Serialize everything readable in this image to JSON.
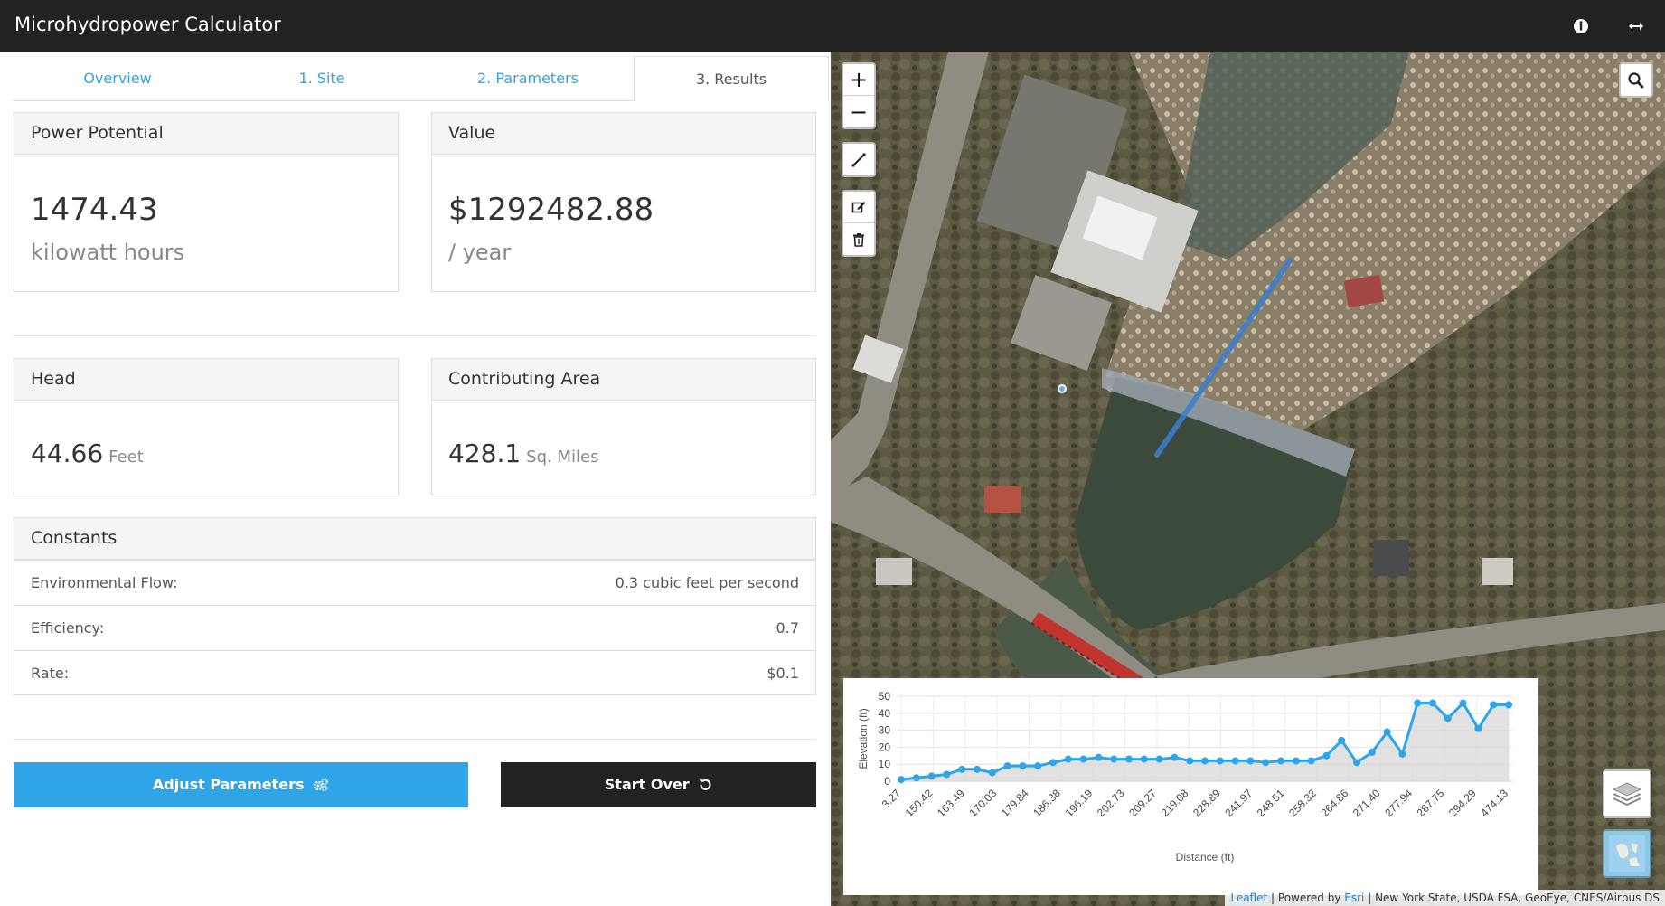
{
  "header": {
    "title": "Microhydropower Calculator"
  },
  "tabs": [
    {
      "label": "Overview"
    },
    {
      "label": "1. Site"
    },
    {
      "label": "2. Parameters"
    },
    {
      "label": "3. Results"
    }
  ],
  "power": {
    "heading": "Power Potential",
    "value": "1474.43",
    "unit": "kilowatt hours"
  },
  "value_panel": {
    "heading": "Value",
    "value": "$1292482.88",
    "unit": "/ year"
  },
  "head": {
    "heading": "Head",
    "value": "44.66",
    "unit": "Feet"
  },
  "area": {
    "heading": "Contributing Area",
    "value": "428.1",
    "unit": "Sq. Miles"
  },
  "constants": {
    "heading": "Constants",
    "rows": [
      {
        "label": "Environmental Flow:",
        "value": "0.3 cubic feet per second"
      },
      {
        "label": "Efficiency:",
        "value": "0.7"
      },
      {
        "label": "Rate:",
        "value": "$0.1"
      }
    ]
  },
  "buttons": {
    "adjust": "Adjust Parameters",
    "start_over": "Start Over"
  },
  "map": {
    "controls": {
      "zoom_in": "+",
      "zoom_out": "−"
    },
    "attribution": {
      "leaflet": "Leaflet",
      "powered_by": "| Powered by",
      "esri": "Esri",
      "sources": "| New York State, USDA FSA, GeoEye, CNES/Airbus DS"
    }
  },
  "colors": {
    "accent": "#2fa4e7",
    "navbar": "#222222",
    "profile_line": "#2fa4e7"
  },
  "chart_data": {
    "type": "area",
    "xlabel": "Distance (ft)",
    "ylabel": "Elevation (ft)",
    "ylim": [
      0,
      50
    ],
    "yticks": [
      0,
      10,
      20,
      30,
      40,
      50
    ],
    "grid": true,
    "x_tick_labels": [
      "3.27",
      "150.42",
      "163.49",
      "170.03",
      "179.84",
      "186.38",
      "196.19",
      "202.73",
      "209.27",
      "219.08",
      "228.89",
      "241.97",
      "248.51",
      "258.32",
      "264.86",
      "271.40",
      "277.94",
      "287.75",
      "294.29",
      "474.13"
    ],
    "values": [
      1,
      2,
      3,
      4,
      7,
      7,
      5,
      9,
      9,
      9,
      11,
      13,
      13,
      14,
      13,
      13,
      13,
      13,
      14,
      12,
      12,
      12,
      12,
      12,
      11,
      12,
      12,
      12,
      15,
      24,
      11,
      17,
      29,
      16,
      46,
      46,
      37,
      46,
      31,
      45,
      45
    ]
  }
}
